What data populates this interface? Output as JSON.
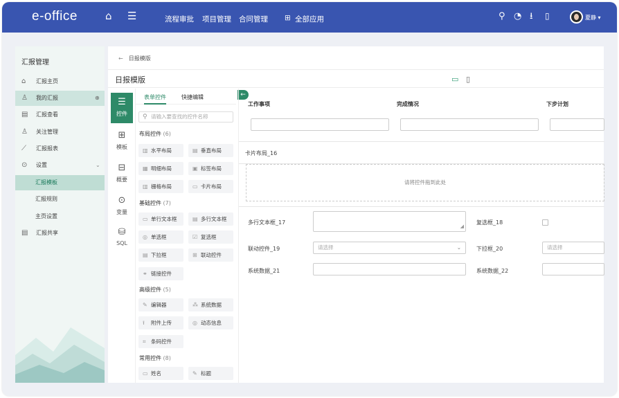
{
  "app": {
    "logo": "e-office",
    "user_name": "夏静"
  },
  "topnav": {
    "items": [
      "流程审批",
      "项目管理",
      "合同管理"
    ],
    "all_apps": "全部应用"
  },
  "sidebar": {
    "title": "汇报管理",
    "items": [
      {
        "label": "汇报主页",
        "icon": "home-icon"
      },
      {
        "label": "我的汇报",
        "icon": "user-icon"
      },
      {
        "label": "汇报查看",
        "icon": "view-report-icon"
      },
      {
        "label": "关注管理",
        "icon": "follow-icon"
      },
      {
        "label": "汇报报表",
        "icon": "chart-icon"
      },
      {
        "label": "设置",
        "icon": "settings-icon"
      },
      {
        "label": "汇报模板"
      },
      {
        "label": "汇报规则"
      },
      {
        "label": "主页设置"
      },
      {
        "label": "汇报共享",
        "icon": "share-icon"
      }
    ]
  },
  "breadcrumb": {
    "text": "日报模版"
  },
  "page": {
    "title": "日报模版"
  },
  "rail": [
    "控件",
    "模板",
    "概要",
    "变量",
    "SQL"
  ],
  "panel": {
    "tabs": [
      "表单控件",
      "快捷编辑"
    ],
    "search_placeholder": "请输入要查找的控件名称",
    "groups": [
      {
        "name": "布局控件",
        "count": "(6)",
        "items": [
          "水平布局",
          "垂直布局",
          "明细布局",
          "标签布局",
          "栅格布局",
          "卡片布局"
        ]
      },
      {
        "name": "基础控件",
        "count": "(7)",
        "items": [
          "单行文本框",
          "多行文本框",
          "单选框",
          "复选框",
          "下拉框",
          "联动控件",
          "链接控件"
        ]
      },
      {
        "name": "高级控件",
        "count": "(5)",
        "items": [
          "编辑器",
          "系统数据",
          "附件上传",
          "动态信息",
          "条码控件"
        ]
      },
      {
        "name": "常用控件",
        "count": "(8)",
        "items": [
          "姓名",
          "标题"
        ]
      }
    ]
  },
  "canvas": {
    "headers": [
      "工作事项",
      "完成情况",
      "下步计划"
    ],
    "card_layout": "卡片布局_16",
    "drop_hint": "请将控件拖到此处",
    "fields": {
      "multiline": "多行文本框_17",
      "checkbox": "复选框_18",
      "linkage": "联动控件_19",
      "linkage_placeholder": "请选择",
      "dropdown": "下拉框_20",
      "dropdown_placeholder": "请选择",
      "sysdata1": "系统数据_21",
      "sysdata2": "系统数据_22"
    }
  },
  "colors": {
    "topbar": "#3955b0",
    "accent": "#2e8a68",
    "sidebar_bg": "#f0f6f4"
  }
}
